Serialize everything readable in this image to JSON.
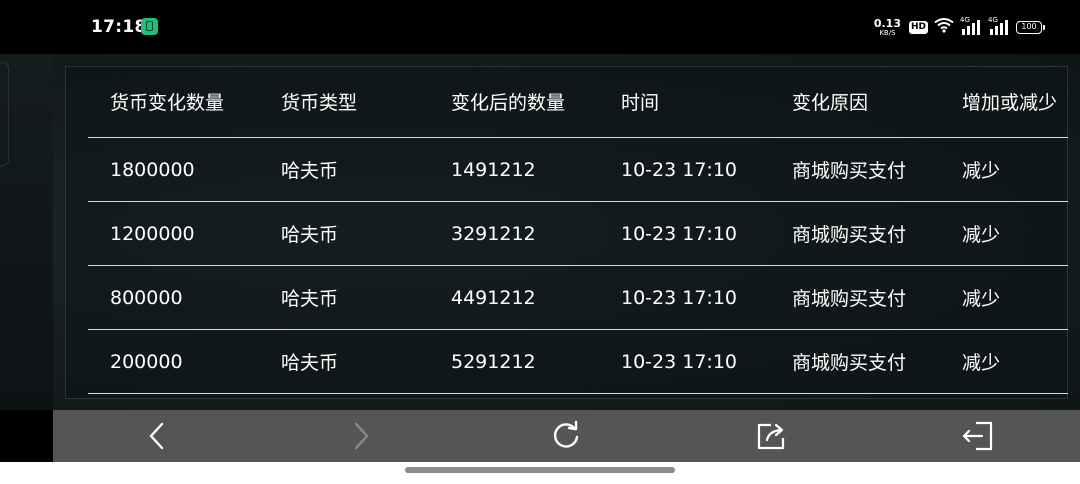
{
  "status_bar": {
    "time": "17:18",
    "net_speed_value": "0.13",
    "net_speed_unit": "KB/S",
    "hd_label": "HD",
    "hd_sub": "1 2",
    "signal1_label": "4G",
    "signal2_label": "4G",
    "battery_level": "100"
  },
  "table": {
    "headers": [
      "货币变化数量",
      "货币类型",
      "变化后的数量",
      "时间",
      "变化原因",
      "增加或减少"
    ],
    "rows": [
      [
        "1800000",
        "哈夫币",
        "1491212",
        "10-23 17:10",
        "商城购买支付",
        "减少"
      ],
      [
        "1200000",
        "哈夫币",
        "3291212",
        "10-23 17:10",
        "商城购买支付",
        "减少"
      ],
      [
        "800000",
        "哈夫币",
        "4491212",
        "10-23 17:10",
        "商城购买支付",
        "减少"
      ],
      [
        "200000",
        "哈夫币",
        "5291212",
        "10-23 17:10",
        "商城购买支付",
        "减少"
      ]
    ]
  },
  "toolbar": {
    "icons": [
      "back-icon",
      "forward-icon",
      "refresh-icon",
      "share-icon",
      "exit-icon"
    ],
    "icon_color": "#ffffff",
    "disabled_icon_color": "#8a8a8a"
  }
}
